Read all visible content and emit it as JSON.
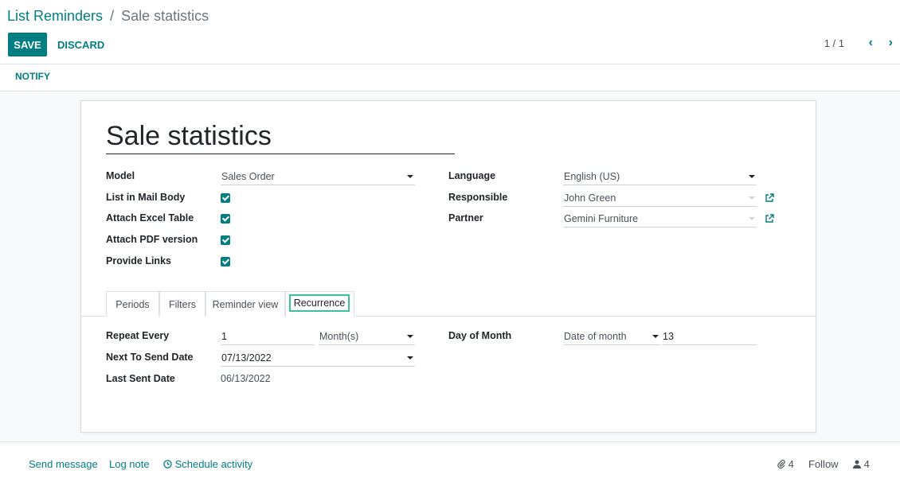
{
  "breadcrumb": {
    "parent": "List Reminders",
    "separator": "/",
    "current": "Sale statistics"
  },
  "toolbar": {
    "save": "SAVE",
    "discard": "DISCARD",
    "notify": "NOTIFY"
  },
  "pager": {
    "value": "1 / 1",
    "prev": "‹",
    "next": "›"
  },
  "record": {
    "name": "Sale statistics"
  },
  "fields": {
    "model": {
      "label": "Model",
      "value": "Sales Order"
    },
    "list_in_mail_body": {
      "label": "List in Mail Body",
      "checked": true
    },
    "attach_excel": {
      "label": "Attach Excel Table",
      "checked": true
    },
    "attach_pdf": {
      "label": "Attach PDF version",
      "checked": true
    },
    "provide_links": {
      "label": "Provide Links",
      "checked": true
    },
    "language": {
      "label": "Language",
      "value": "English (US)"
    },
    "responsible": {
      "label": "Responsible",
      "value": "John Green"
    },
    "partner": {
      "label": "Partner",
      "value": "Gemini Furniture"
    }
  },
  "tabs": [
    {
      "label": "Periods"
    },
    {
      "label": "Filters"
    },
    {
      "label": "Reminder view"
    },
    {
      "label": "Recurrence"
    }
  ],
  "recurrence": {
    "repeat_every": {
      "label": "Repeat Every",
      "value": "1",
      "unit": "Month(s)"
    },
    "next_send": {
      "label": "Next To Send Date",
      "value": "07/13/2022"
    },
    "last_sent": {
      "label": "Last Sent Date",
      "value": "06/13/2022"
    },
    "day_of_month": {
      "label": "Day of Month",
      "mode": "Date of month",
      "value": "13"
    }
  },
  "chatter": {
    "send_message": "Send message",
    "log_note": "Log note",
    "schedule_activity": "Schedule activity",
    "attachments": "4",
    "follow": "Follow",
    "followers": "4"
  },
  "colors": {
    "accent": "#017e84",
    "tab_highlight": "#3fbf9f"
  }
}
